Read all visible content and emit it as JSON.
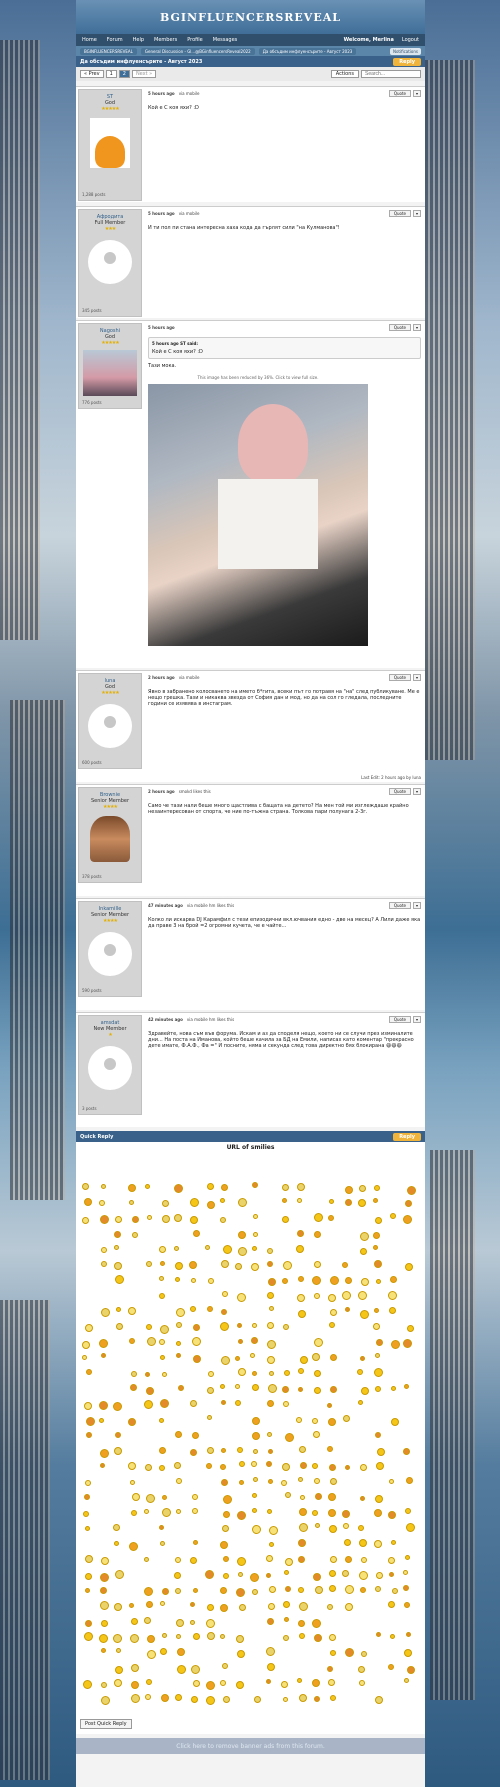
{
  "site": {
    "title": "BGINFLUENCERSREVEAL"
  },
  "nav": {
    "items": [
      "Home",
      "Forum",
      "Help",
      "Members",
      "Profile",
      "Messages"
    ],
    "welcome": "Welcome, Merlina",
    "logout": "Logout"
  },
  "breadcrumbs": [
    "BGINFLUENCERSREVEAL",
    "General Discussion - Gl...@BGinfluencersReveal2022",
    "Да обсъдим инфлуенсърите - Август 2023"
  ],
  "breadcrumb_button": "Notifications",
  "topic": {
    "title": "Да обсъдим инфлуенсърите - Август 2023",
    "reply_label": "Reply"
  },
  "pager": {
    "prev": "« Prev",
    "pages": [
      "1",
      "2"
    ],
    "next": "Next »",
    "actions": "Actions",
    "search_placeholder": "Search..."
  },
  "posts": [
    {
      "user": "ST",
      "rank": "God",
      "stars": "★★★★★",
      "posts": "1,288 posts",
      "time": "5 hours ago",
      "via": "via mobile",
      "quote": "Quote",
      "text": "Кой е С коя яхи? :D"
    },
    {
      "user": "Афродита",
      "rank": "Full Member",
      "stars": "★★★",
      "posts": "345 posts",
      "time": "5 hours ago",
      "via": "via mobile",
      "quote": "Quote",
      "text": "И ти пол пи стана интересна хаха кода да гърлят сили \"на Кулманова\"!"
    },
    {
      "user": "Nagoshi",
      "rank": "God",
      "stars": "★★★★★",
      "posts": "776 posts",
      "time": "5 hours ago",
      "via": "",
      "quote": "Quote",
      "quote_meta": "5 hours ago ST said:",
      "quote_text": "Кой е С коя яхи? :D",
      "text": "Тази мока.",
      "image_note": "This image has been reduced by 36%. Click to view full size."
    },
    {
      "user": "luna",
      "rank": "God",
      "stars": "★★★★★",
      "posts": "600 posts",
      "time": "2 hours ago",
      "via": "via mobile",
      "quote": "Quote",
      "text": "Явно в забранено колосването на името б*гита, всеки път го потравя на \"на\" след публикуване. Ме е нещо грешка. Тази и никаква звезда от София дан и мод, но да на сол го гледала, последните години се изявява в инстаграм.",
      "last_edit": "Last Edit: 2 hours ago by luna"
    },
    {
      "user": "Brownie",
      "rank": "Senior Member",
      "stars": "★★★★",
      "posts": "378 posts",
      "time": "2 hours ago",
      "via": "smokd likes this",
      "quote": "Quote",
      "text": "Само че тази нали беше много щастлива с бащата на детето? На мен той ми изглеждаше крайно незаинтересован от спорта, че ние по-тъжна страна. Толкова пари полунага 2-3г."
    },
    {
      "user": "Inkamille",
      "rank": "Senior Member",
      "stars": "★★★★",
      "posts": "590 posts",
      "time": "47 minutes ago",
      "via": "via mobile hm likes this",
      "quote": "Quote",
      "text": "Колко ли искарва DJ Карамфил с тези епизодични вкл.ючвания едно - две на месец? А Лили даже яка да праве 3 на брой =2 огромни кучета, че е чайте..."
    },
    {
      "user": "amsdat",
      "rank": "New Member",
      "stars": "★",
      "posts": "3 posts",
      "time": "42 minutes ago",
      "via": "via mobile hm likes this",
      "quote": "Quote",
      "text": "Здравейте, нова съм във форума. Искам и аз да споделя нещо, което ни се случи през изминалите дни... На поста на Иманова, който беше качила за БД на Емили, написах като коментар \"прекрасно дете имате, Ф.А.Ф., Фа =\" И посните, няма и секунда след това директно бях блокирана 😄😄😄"
    }
  ],
  "quick_reply": {
    "title": "Quick Reply",
    "reply_label": "Reply",
    "smilies_title": "URL of smilies",
    "post_button": "Post Quick Reply"
  },
  "remove_banner": "Click here to remove banner ads from this forum."
}
